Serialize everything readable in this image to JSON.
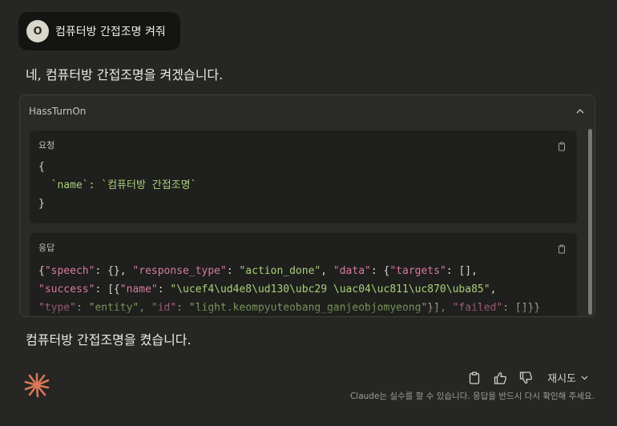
{
  "user_message": {
    "avatar_initial": "O",
    "text": "컴퓨터방 간접조명 켜줘"
  },
  "assistant": {
    "reply_intro": "네, 컴퓨터방 간접조명을 켜겠습니다.",
    "reply_final": "컴퓨터방 간접조명을 켰습니다."
  },
  "tool_call": {
    "name": "HassTurnOn",
    "collapse_icon": "chevron-up-icon",
    "request": {
      "label": "요청",
      "lines": [
        "{",
        "  `name`: `컴퓨터방 간접조명`",
        "}"
      ]
    },
    "response": {
      "label": "응답",
      "line1": "{\"speech\": {}, \"response_type\": \"action_done\", \"data\": {\"targets\": [],",
      "line2": "\"success\": [{\"name\": \"\\ucef4\\ud4e8\\ud130\\ubc29 \\uac04\\uc811\\uc870\\uba85\",",
      "line3": "\"type\": \"entity\", \"id\": \"light.keompyuteobang_ganjeobjomyeong\"}], \"failed\": []}}"
    }
  },
  "footer": {
    "retry_label": "재시도",
    "disclaimer": "Claude는 실수를 할 수 있습니다. 응답을 반드시 다시 확인해 주세요.",
    "icons": [
      "copy-icon",
      "thumbs-up-icon",
      "thumbs-down-icon",
      "chevron-down-icon"
    ]
  },
  "colors": {
    "background": "#262624",
    "accent_logo": "#d97757",
    "json_key": "#d57ba0",
    "json_string": "#a8d17a"
  }
}
